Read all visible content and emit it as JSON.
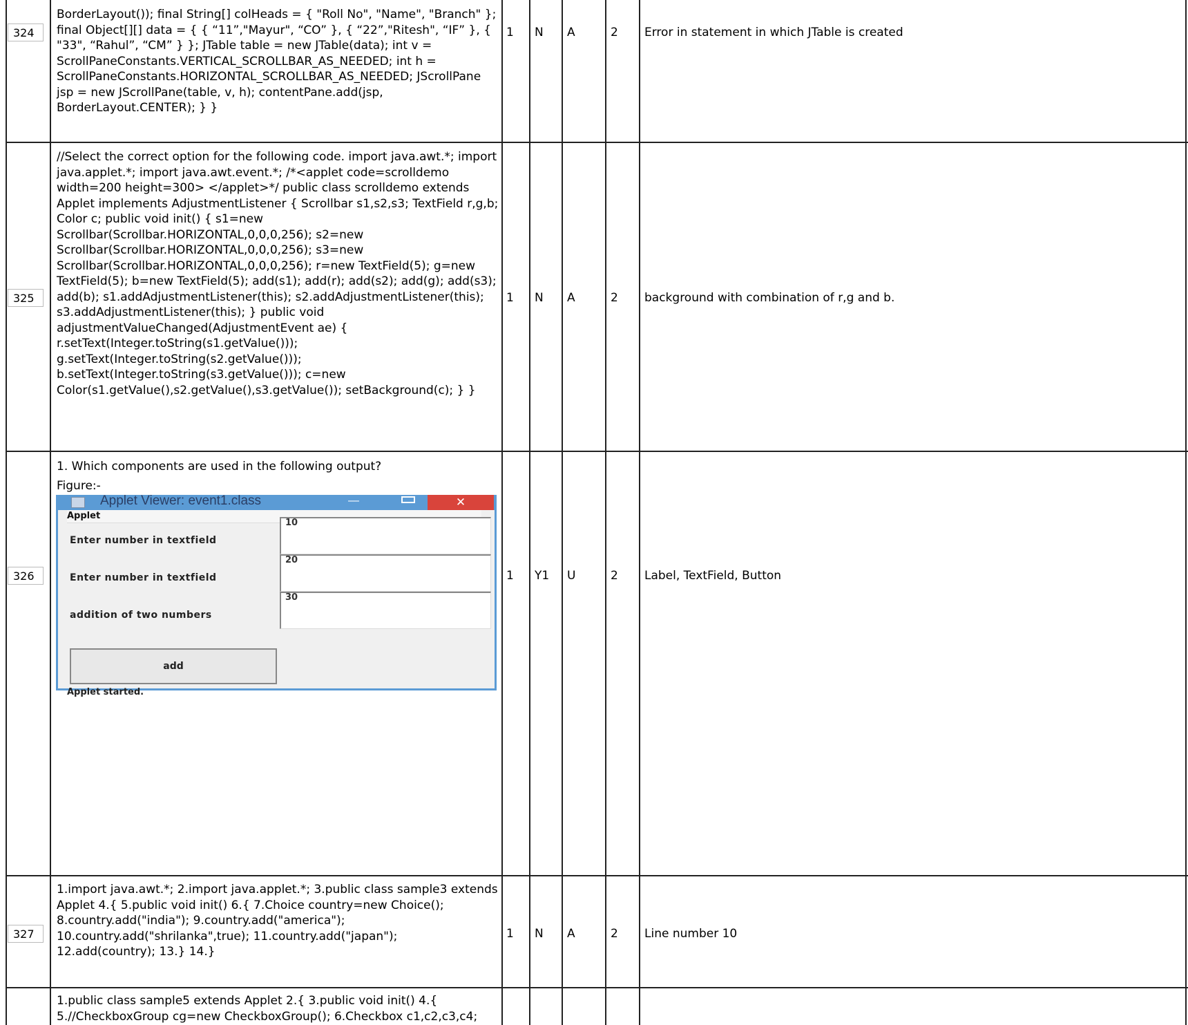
{
  "rows": [
    {
      "number": "324",
      "question": "BorderLayout()); final String[] colHeads = { \"Roll No\", \"Name\", \"Branch\" }; final Object[][] data = { { “11”,\"Mayur\", “CO” }, { “22”,\"Ritesh\", “IF” }, { \"33\", “Rahul”, “CM” } }; JTable table = new JTable(data); int v = ScrollPaneConstants.VERTICAL_SCROLLBAR_AS_NEEDED; int h = ScrollPaneConstants.HORIZONTAL_SCROLLBAR_AS_NEEDED; JScrollPane jsp = new JScrollPane(table, v, h); contentPane.add(jsp, BorderLayout.CENTER); } }",
      "marks": "1",
      "flag": "N",
      "level": "A",
      "co": "2",
      "answer": "Error in statement in which JTable is created"
    },
    {
      "number": "325",
      "question": "//Select the correct option for the following code. import java.awt.*; import java.applet.*; import java.awt.event.*; /*<applet code=scrolldemo width=200 height=300> </applet>*/ public class scrolldemo extends Applet implements AdjustmentListener { Scrollbar s1,s2,s3; TextField r,g,b; Color c; public void init() { s1=new Scrollbar(Scrollbar.HORIZONTAL,0,0,0,256); s2=new Scrollbar(Scrollbar.HORIZONTAL,0,0,0,256); s3=new Scrollbar(Scrollbar.HORIZONTAL,0,0,0,256); r=new TextField(5); g=new TextField(5); b=new TextField(5); add(s1); add(r); add(s2); add(g); add(s3); add(b); s1.addAdjustmentListener(this); s2.addAdjustmentListener(this); s3.addAdjustmentListener(this); } public void adjustmentValueChanged(AdjustmentEvent ae) { r.setText(Integer.toString(s1.getValue())); g.setText(Integer.toString(s2.getValue())); b.setText(Integer.toString(s3.getValue())); c=new Color(s1.getValue(),s2.getValue(),s3.getValue()); setBackground(c); } }",
      "marks": "1",
      "flag": "N",
      "level": "A",
      "co": "2",
      "answer": "background with combination of r,g and b."
    },
    {
      "number": "326",
      "question": "1. Which components are used in the following output?",
      "figure_label": "Figure:-",
      "marks": "1",
      "flag": "Y1",
      "level": "U",
      "co": "2",
      "answer": "Label, TextField, Button"
    },
    {
      "number": "327",
      "question": "1.import java.awt.*; 2.import java.applet.*; 3.public class sample3 extends Applet 4.{ 5.public void init() 6.{ 7.Choice country=new Choice(); 8.country.add(\"india\"); 9.country.add(\"america\"); 10.country.add(\"shrilanka\",true); 11.country.add(\"japan\"); 12.add(country); 13.} 14.}",
      "marks": "1",
      "flag": "N",
      "level": "A",
      "co": "2",
      "answer": "Line number 10"
    },
    {
      "number": "",
      "question": "1.public class sample5 extends Applet 2.{ 3.public void init() 4.{ 5.//CheckboxGroup cg=new CheckboxGroup(); 6.Checkbox c1,c2,c3,c4;"
    }
  ],
  "applet": {
    "title": "Applet Viewer: event1.class",
    "menu": "Applet",
    "labels": [
      "Enter number in textfield",
      "Enter number in textfield",
      "addition of two numbers"
    ],
    "fields": [
      "10",
      "20",
      "30"
    ],
    "button": "add",
    "status": "Applet started.",
    "min_glyph": "—",
    "close_glyph": "✕"
  }
}
